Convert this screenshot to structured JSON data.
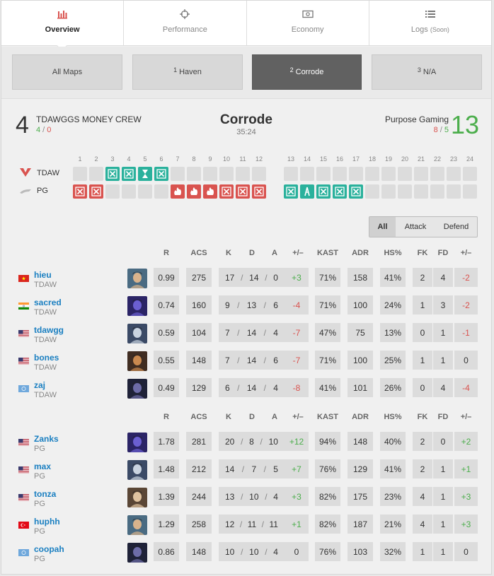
{
  "tabs": [
    {
      "label": "Overview",
      "icon": "bar-chart-icon",
      "active": true
    },
    {
      "label": "Performance",
      "icon": "crosshair-icon",
      "active": false
    },
    {
      "label": "Economy",
      "icon": "money-icon",
      "active": false
    },
    {
      "label": "Logs",
      "suffix": "(Soon)",
      "icon": "list-icon",
      "active": false
    }
  ],
  "maps": [
    {
      "num": "",
      "label": "All Maps"
    },
    {
      "num": "1",
      "label": "Haven"
    },
    {
      "num": "2",
      "label": "Corrode"
    },
    {
      "num": "3",
      "label": "N/A"
    }
  ],
  "match": {
    "team1": {
      "name": "TDAWGGS MONEY CREW",
      "score": "4",
      "eco_a": "4",
      "eco_b": "0",
      "short": "TDAW"
    },
    "team2": {
      "name": "Purpose Gaming",
      "score": "13",
      "eco_a": "8",
      "eco_b": "5",
      "short": "PG"
    },
    "map": "Corrode",
    "duration": "35:24"
  },
  "round_numbers": [
    "1",
    "2",
    "3",
    "4",
    "5",
    "6",
    "7",
    "8",
    "9",
    "10",
    "11",
    "12",
    "13",
    "14",
    "15",
    "16",
    "17",
    "18",
    "19",
    "20",
    "21",
    "22",
    "23",
    "24"
  ],
  "rounds": {
    "team1": [
      "",
      "",
      "elim",
      "elim",
      "time",
      "elim",
      "",
      "",
      "",
      "",
      "",
      "",
      "",
      "",
      "",
      "",
      "",
      "",
      "",
      "",
      "",
      "",
      "",
      ""
    ],
    "team2": [
      "elim",
      "elim",
      "",
      "",
      "",
      "",
      "boom",
      "boom",
      "boom",
      "elim",
      "elim",
      "elim",
      "elim",
      "defuse",
      "elim",
      "elim",
      "elim",
      "",
      "",
      "",
      "",
      "",
      "",
      ""
    ]
  },
  "filter": {
    "all": "All",
    "attack": "Attack",
    "defend": "Defend"
  },
  "columns": [
    "R",
    "ACS",
    "K",
    "D",
    "A",
    "+/–",
    "KAST",
    "ADR",
    "HS%",
    "FK",
    "FD",
    "+/–"
  ],
  "team1_players": [
    {
      "name": "hieu",
      "team": "TDAW",
      "flag": "vn",
      "agent": "a1",
      "r": "0.99",
      "acs": "275",
      "k": "17",
      "d": "14",
      "a": "0",
      "pm": "+3",
      "kast": "71%",
      "adr": "158",
      "hs": "41%",
      "fk": "2",
      "fd": "4",
      "fpm": "-2"
    },
    {
      "name": "sacred",
      "team": "TDAW",
      "flag": "in",
      "agent": "a2",
      "r": "0.74",
      "acs": "160",
      "k": "9",
      "d": "13",
      "a": "6",
      "pm": "-4",
      "kast": "71%",
      "adr": "100",
      "hs": "24%",
      "fk": "1",
      "fd": "3",
      "fpm": "-2"
    },
    {
      "name": "tdawgg",
      "team": "TDAW",
      "flag": "us",
      "agent": "a3",
      "r": "0.59",
      "acs": "104",
      "k": "7",
      "d": "14",
      "a": "4",
      "pm": "-7",
      "kast": "47%",
      "adr": "75",
      "hs": "13%",
      "fk": "0",
      "fd": "1",
      "fpm": "-1"
    },
    {
      "name": "bones",
      "team": "TDAW",
      "flag": "us",
      "agent": "a4",
      "r": "0.55",
      "acs": "148",
      "k": "7",
      "d": "14",
      "a": "6",
      "pm": "-7",
      "kast": "71%",
      "adr": "100",
      "hs": "25%",
      "fk": "1",
      "fd": "1",
      "fpm": "0"
    },
    {
      "name": "zaj",
      "team": "TDAW",
      "flag": "un",
      "agent": "a5",
      "r": "0.49",
      "acs": "129",
      "k": "6",
      "d": "14",
      "a": "4",
      "pm": "-8",
      "kast": "41%",
      "adr": "101",
      "hs": "26%",
      "fk": "0",
      "fd": "4",
      "fpm": "-4"
    }
  ],
  "team2_players": [
    {
      "name": "Zanks",
      "team": "PG",
      "flag": "us",
      "agent": "a2",
      "r": "1.78",
      "acs": "281",
      "k": "20",
      "d": "8",
      "a": "10",
      "pm": "+12",
      "kast": "94%",
      "adr": "148",
      "hs": "40%",
      "fk": "2",
      "fd": "0",
      "fpm": "+2"
    },
    {
      "name": "max",
      "team": "PG",
      "flag": "us",
      "agent": "a3",
      "r": "1.48",
      "acs": "212",
      "k": "14",
      "d": "7",
      "a": "5",
      "pm": "+7",
      "kast": "76%",
      "adr": "129",
      "hs": "41%",
      "fk": "2",
      "fd": "1",
      "fpm": "+1"
    },
    {
      "name": "tonza",
      "team": "PG",
      "flag": "us",
      "agent": "a6",
      "r": "1.39",
      "acs": "244",
      "k": "13",
      "d": "10",
      "a": "4",
      "pm": "+3",
      "kast": "82%",
      "adr": "175",
      "hs": "23%",
      "fk": "4",
      "fd": "1",
      "fpm": "+3"
    },
    {
      "name": "huphh",
      "team": "PG",
      "flag": "tr",
      "agent": "a1",
      "r": "1.29",
      "acs": "258",
      "k": "12",
      "d": "11",
      "a": "11",
      "pm": "+1",
      "kast": "82%",
      "adr": "187",
      "hs": "21%",
      "fk": "4",
      "fd": "1",
      "fpm": "+3"
    },
    {
      "name": "coopah",
      "team": "PG",
      "flag": "un",
      "agent": "a5",
      "r": "0.86",
      "acs": "148",
      "k": "10",
      "d": "10",
      "a": "4",
      "pm": "0",
      "kast": "76%",
      "adr": "103",
      "hs": "32%",
      "fk": "1",
      "fd": "1",
      "fpm": "0"
    }
  ],
  "colors": {
    "win_green": "#2ab19c",
    "win_red": "#d9534f",
    "link": "#1a7fc1",
    "positive": "#4cae4c",
    "negative": "#d9534f"
  }
}
